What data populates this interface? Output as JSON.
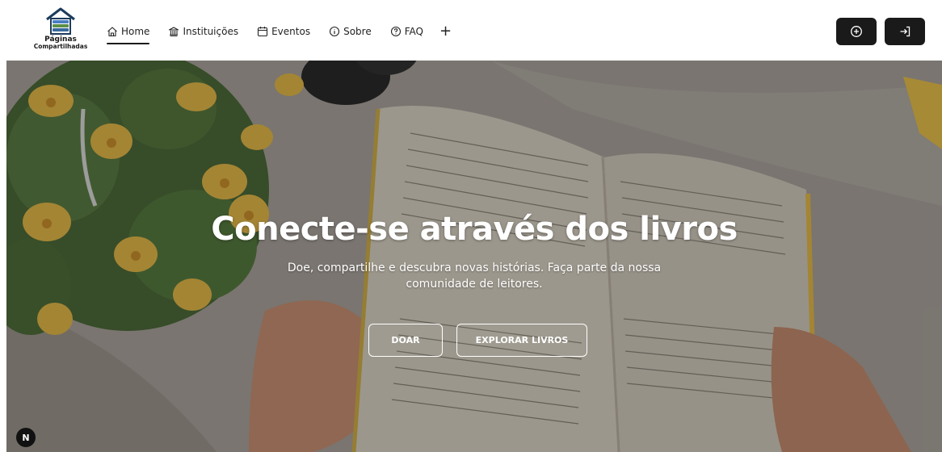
{
  "brand": {
    "line1": "Páginas",
    "line2": "Compartilhadas",
    "icon": "books-house-icon"
  },
  "nav": {
    "items": [
      {
        "label": "Home",
        "icon": "house-icon",
        "active": true
      },
      {
        "label": "Instituições",
        "icon": "bank-icon",
        "active": false
      },
      {
        "label": "Eventos",
        "icon": "calendar-icon",
        "active": false
      },
      {
        "label": "Sobre",
        "icon": "info-icon",
        "active": false
      },
      {
        "label": "FAQ",
        "icon": "help-icon",
        "active": false
      }
    ],
    "more": "+"
  },
  "actions": {
    "add_icon": "plus-circle-icon",
    "login_icon": "login-icon"
  },
  "hero": {
    "title": "Conecte-se através dos livros",
    "subtitle": "Doe, compartilhe e descubra novas histórias. Faça parte da nossa comunidade de leitores.",
    "donate": "DOAR",
    "explore": "EXPLORAR LIVROS"
  },
  "badge": {
    "label": "N"
  },
  "colors": {
    "dark": "#1a1a1a",
    "accent_blue": "#4a7fc2",
    "accent_green": "#5c8f4a"
  }
}
